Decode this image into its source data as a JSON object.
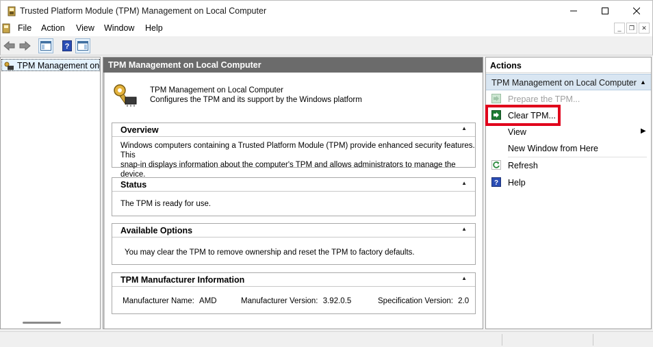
{
  "window": {
    "title": "Trusted Platform Module (TPM) Management on Local Computer",
    "icon": "tpm-app-icon",
    "controls": [
      "minimize-icon",
      "maximize-icon",
      "close-icon"
    ]
  },
  "menubar": {
    "items": [
      "File",
      "Action",
      "View",
      "Window",
      "Help"
    ],
    "mdi_controls": [
      "_",
      "❐",
      "✕"
    ]
  },
  "toolbar": {
    "buttons": [
      "back-arrow-icon",
      "forward-arrow-icon",
      "show-hide-console-tree-icon",
      "help-icon",
      "show-hide-action-pane-icon"
    ]
  },
  "tree": {
    "node_label": "TPM Management on Local Computer"
  },
  "center": {
    "header": "TPM Management on Local Computer",
    "intro_title": "TPM Management on Local Computer",
    "intro_desc": "Configures the TPM and its support by the Windows platform",
    "sections": {
      "overview": {
        "title": "Overview",
        "line1": "Windows computers containing a Trusted Platform Module (TPM) provide enhanced security features. This",
        "line2": "snap-in displays information about the computer's TPM and allows administrators to manage the device."
      },
      "status": {
        "title": "Status",
        "text": "The TPM is ready for use."
      },
      "options": {
        "title": "Available Options",
        "text": "You may clear the TPM to remove ownership and reset the TPM to factory defaults."
      },
      "manufacturer": {
        "title": "TPM Manufacturer Information",
        "name_label": "Manufacturer Name:",
        "name_value": "AMD",
        "version_label": "Manufacturer Version:",
        "version_value": "3.92.0.5",
        "spec_label": "Specification Version:",
        "spec_value": "2.0"
      }
    }
  },
  "actions": {
    "title": "Actions",
    "group": "TPM Management on Local Computer",
    "items": [
      {
        "label": "Prepare the TPM...",
        "enabled": false,
        "icon": "action-arrow-icon"
      },
      {
        "label": "Clear TPM...",
        "enabled": true,
        "icon": "action-arrow-icon",
        "highlighted": true
      },
      {
        "label": "View",
        "enabled": true,
        "submenu": true
      },
      {
        "label": "New Window from Here",
        "enabled": true
      },
      {
        "label": "Refresh",
        "enabled": true,
        "icon": "refresh-icon"
      },
      {
        "label": "Help",
        "enabled": true,
        "icon": "help-icon"
      }
    ]
  },
  "colors": {
    "header_bg": "#6b6b6b",
    "group_bg": "#d9e6f2",
    "highlight": "#e0001b",
    "action_icon_green": "#1e7b34"
  }
}
